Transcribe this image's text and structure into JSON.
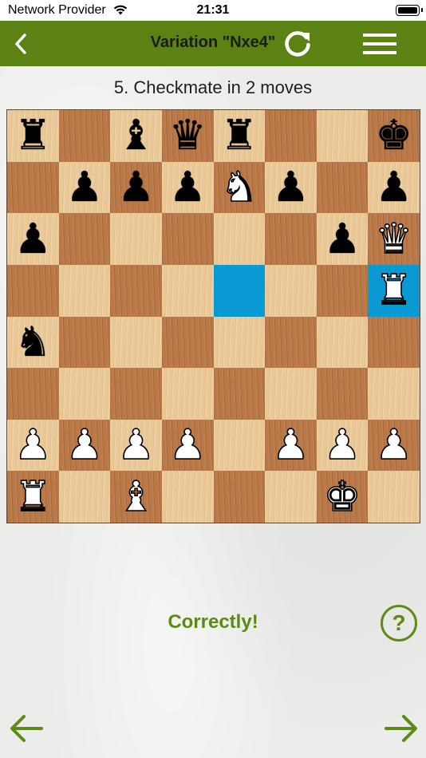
{
  "status_bar": {
    "carrier": "Network Provider",
    "time": "21:31",
    "wifi_icon": "wifi-icon",
    "battery_icon": "battery-icon"
  },
  "nav": {
    "title": "Variation \"Nxe4\"",
    "back_icon": "chevron-left-icon",
    "refresh_icon": "refresh-icon",
    "menu_icon": "hamburger-menu-icon",
    "color": "#5b8213"
  },
  "puzzle": {
    "subtitle": "5. Checkmate in 2 moves"
  },
  "board": {
    "highlight_color": "#0a9ad3",
    "highlighted_squares": [
      "e5",
      "h5"
    ],
    "ranks": [
      [
        "bR",
        "",
        "bB",
        "bQ",
        "bR",
        "",
        "",
        "bK"
      ],
      [
        "",
        "bP",
        "bP",
        "bP",
        "wN",
        "bP",
        "",
        "bP"
      ],
      [
        "bP",
        "",
        "",
        "",
        "",
        "",
        "bP",
        "wQ"
      ],
      [
        "",
        "",
        "",
        "",
        "",
        "",
        "",
        "wR"
      ],
      [
        "bN",
        "",
        "",
        "",
        "",
        "",
        "",
        ""
      ],
      [
        "",
        "",
        "",
        "",
        "",
        "",
        "",
        ""
      ],
      [
        "wP",
        "wP",
        "wP",
        "wP",
        "",
        "wP",
        "wP",
        "wP"
      ],
      [
        "wR",
        "",
        "wB",
        "",
        "",
        "",
        "wK",
        ""
      ]
    ]
  },
  "feedback": {
    "text": "Correctly!",
    "color": "#5b8a17"
  },
  "help": {
    "label": "?",
    "icon": "help-circle-icon"
  },
  "footer": {
    "prev_icon": "arrow-left-icon",
    "next_icon": "arrow-right-icon"
  }
}
